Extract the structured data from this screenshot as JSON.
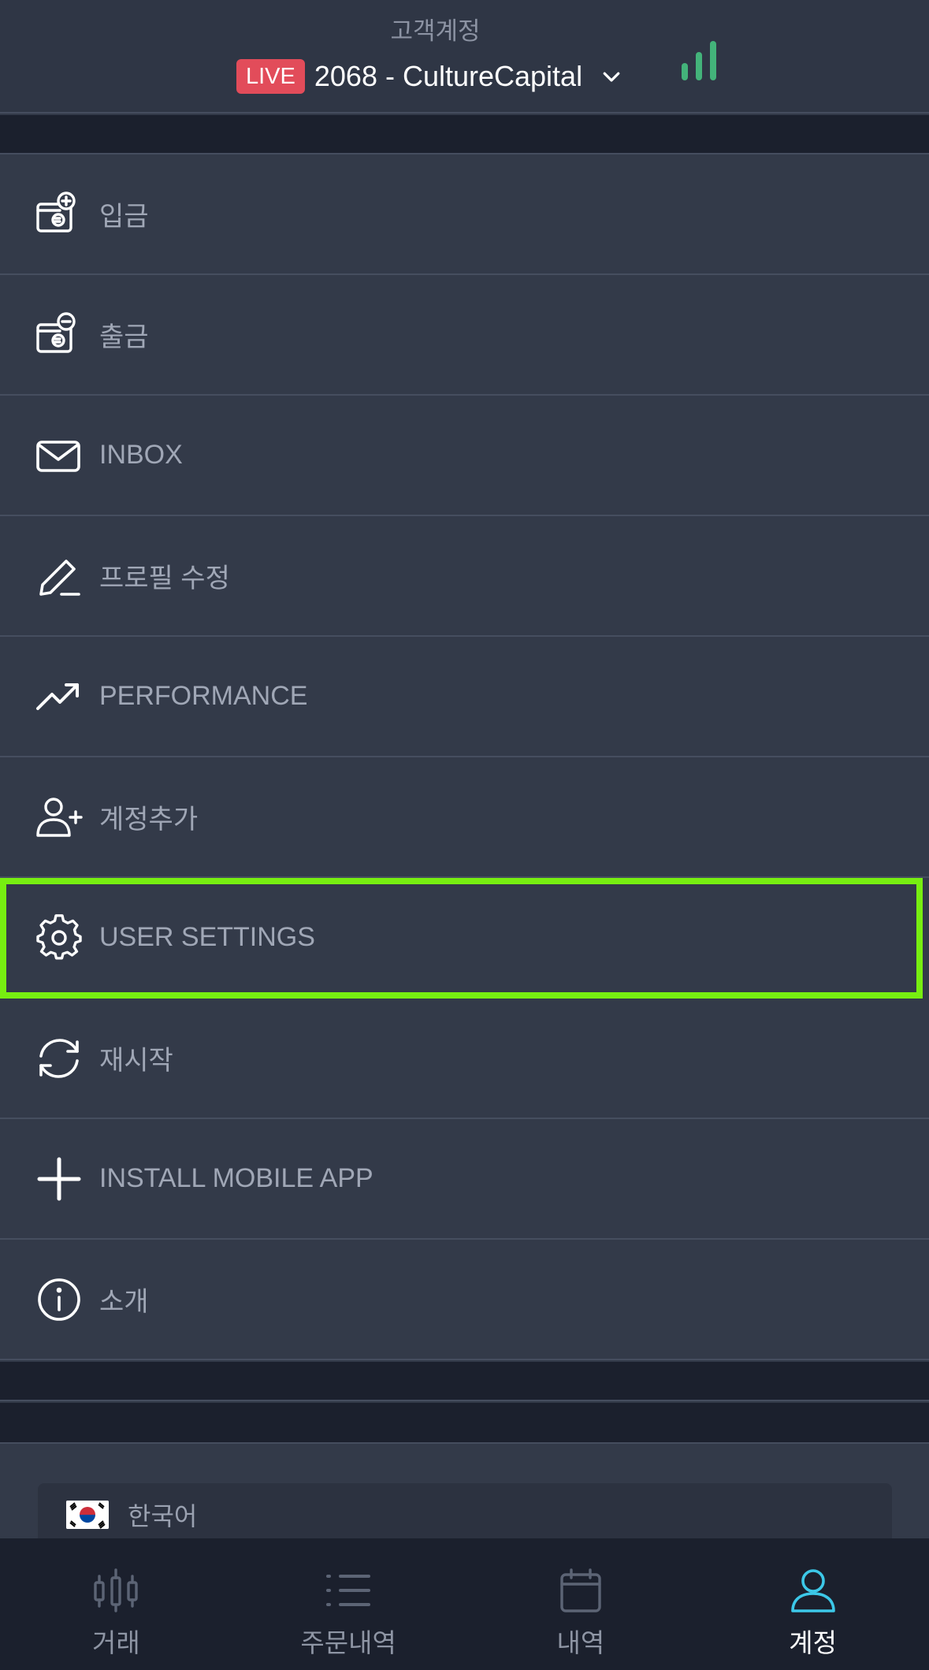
{
  "header": {
    "caption": "고객계정",
    "badge": "LIVE",
    "account": "2068 - CultureCapital"
  },
  "menu": [
    {
      "label": "입금",
      "icon": "wallet-plus-icon"
    },
    {
      "label": "출금",
      "icon": "wallet-minus-icon"
    },
    {
      "label": "INBOX",
      "icon": "mail-icon"
    },
    {
      "label": "프로필 수정",
      "icon": "pen-icon"
    },
    {
      "label": "PERFORMANCE",
      "icon": "trending-up-icon"
    },
    {
      "label": "계정추가",
      "icon": "user-plus-icon"
    },
    {
      "label": "USER SETTINGS",
      "icon": "gear-icon"
    },
    {
      "label": "재시작",
      "icon": "refresh-icon"
    },
    {
      "label": "INSTALL MOBILE APP",
      "icon": "plus-icon"
    },
    {
      "label": "소개",
      "icon": "info-icon"
    }
  ],
  "language": {
    "label": "한국어"
  },
  "nav": [
    {
      "label": "거래",
      "icon": "candlestick-icon"
    },
    {
      "label": "주문내역",
      "icon": "list-icon"
    },
    {
      "label": "내역",
      "icon": "calendar-icon"
    },
    {
      "label": "계정",
      "icon": "user-icon",
      "active": true
    }
  ],
  "colors": {
    "accent_active": "#3cc8e8",
    "live_badge": "#e24c5a",
    "signal": "#43b37a",
    "highlight": "#77ee11"
  }
}
